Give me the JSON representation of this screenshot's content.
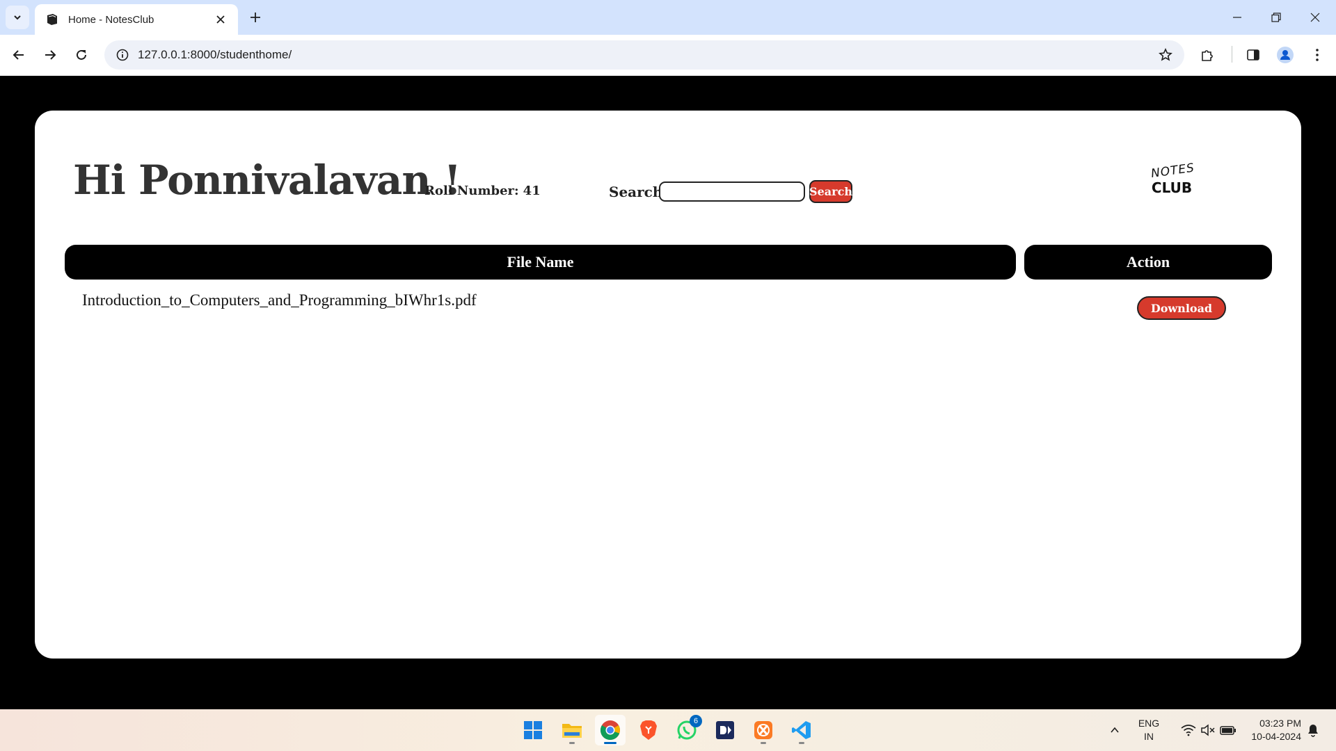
{
  "browser": {
    "tab_title": "Home - NotesClub",
    "url": "127.0.0.1:8000/studenthome/"
  },
  "page": {
    "greeting": "Hi Ponnivalavan !",
    "roll_label": "Roll Number:",
    "roll_value": "41",
    "search_label": "Search:",
    "search_value": "",
    "search_button": "Search",
    "logo_line1": "NOTES",
    "logo_line2": "CLUB",
    "table": {
      "headers": [
        "File Name",
        "Action"
      ],
      "rows": [
        {
          "file_name": "Introduction_to_Computers_and_Programming_bIWhr1s.pdf",
          "action": "Download"
        }
      ]
    },
    "colors": {
      "accent": "#d63a2c",
      "header_bg": "#000000"
    }
  },
  "taskbar": {
    "whatsapp_badge": "6",
    "lang_line1": "ENG",
    "lang_line2": "IN",
    "time": "03:23 PM",
    "date": "10-04-2024"
  }
}
